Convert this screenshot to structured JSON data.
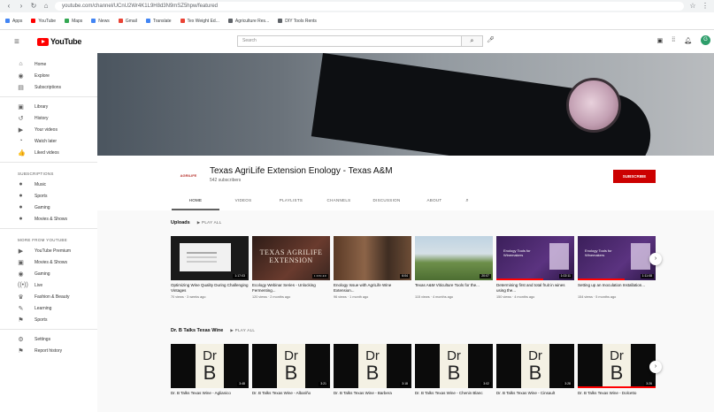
{
  "browser": {
    "url": "youtube.com/channel/UCnU2Wr4K1L9H8d3N9mSZ5hpw/featured",
    "bookmarks": [
      "Apps",
      "YouTube",
      "Maps",
      "News",
      "Gmail",
      "Translate",
      "Tex Weight Ed...",
      "Agriculture Res...",
      "DIY Tools Rents"
    ]
  },
  "masthead": {
    "logo_text": "YouTube",
    "search_placeholder": "Search"
  },
  "sidebar": {
    "main": [
      {
        "icon": "⌂",
        "label": "Home"
      },
      {
        "icon": "◉",
        "label": "Explore"
      },
      {
        "icon": "▤",
        "label": "Subscriptions"
      }
    ],
    "library": [
      {
        "icon": "▣",
        "label": "Library"
      },
      {
        "icon": "↺",
        "label": "History"
      },
      {
        "icon": "▶",
        "label": "Your videos"
      },
      {
        "icon": "◔",
        "label": "Watch later"
      },
      {
        "icon": "👍",
        "label": "Liked videos"
      }
    ],
    "subscriptions_heading": "SUBSCRIPTIONS",
    "subscriptions": [
      {
        "icon": "●",
        "label": "Music"
      },
      {
        "icon": "●",
        "label": "Sports"
      },
      {
        "icon": "●",
        "label": "Gaming"
      },
      {
        "icon": "●",
        "label": "Movies & Shows"
      }
    ],
    "more_heading": "MORE FROM YOUTUBE",
    "more": [
      {
        "icon": "▶",
        "label": "YouTube Premium"
      },
      {
        "icon": "▣",
        "label": "Movies & Shows"
      },
      {
        "icon": "◉",
        "label": "Gaming"
      },
      {
        "icon": "((•))",
        "label": "Live"
      },
      {
        "icon": "♛",
        "label": "Fashion & Beauty"
      },
      {
        "icon": "✎",
        "label": "Learning"
      },
      {
        "icon": "⚑",
        "label": "Sports"
      }
    ],
    "bottom": [
      {
        "icon": "⚙",
        "label": "Settings"
      },
      {
        "icon": "⚑",
        "label": "Report history"
      }
    ]
  },
  "channel": {
    "avatar_text": "AGRILIFE",
    "title": "Texas AgriLife Extension Enology - Texas A&M",
    "subscribers": "542 subscribers",
    "subscribe_label": "SUBSCRIBE",
    "tabs": [
      "HOME",
      "VIDEOS",
      "PLAYLISTS",
      "CHANNELS",
      "DISCUSSION",
      "ABOUT"
    ]
  },
  "shelf1": {
    "title": "Uploads",
    "play_all": "▶ PLAY ALL",
    "videos": [
      {
        "title": "Optimizing Wine Quality During Challenging Vintages",
        "meta": "70 views · 3 weeks ago",
        "duration": "1:17:03",
        "thumb": "slide"
      },
      {
        "title": "Ecology Webinar Series - Unlocking Fermenting...",
        "meta": "120 views · 2 months ago",
        "duration": "1:06:40",
        "thumb": "agri",
        "thumb_text": "TEXAS AGRILIFE EXTENSION"
      },
      {
        "title": "Enology Issue with AgriLife Wine Extension...",
        "meta": "96 views · 1 month ago",
        "duration": "6:04",
        "thumb": "people"
      },
      {
        "title": "Texas A&M Viticulture Tools for the...",
        "meta": "115 views · 4 months ago",
        "duration": "20:07",
        "thumb": "vine"
      },
      {
        "title": "Determining first and total fruit in wines using the...",
        "meta": "150 views · 4 months ago",
        "duration": "1:02:11",
        "thumb": "purple",
        "thumb_text": "Enology Tools for Winemakers"
      },
      {
        "title": "Setting up an Inoculation Installation...",
        "meta": "154 views · 5 months ago",
        "duration": "1:11:08",
        "thumb": "purple",
        "thumb_text": "Enology Tools for Winemakers"
      }
    ]
  },
  "shelf2": {
    "title": "Dr. B Talks Texas Wine",
    "play_all": "▶ PLAY ALL",
    "videos": [
      {
        "title": "Dr. B Talks Texas Wine - Aglianico",
        "duration": "3:48"
      },
      {
        "title": "Dr. B Talks Texas Wine - Albariño",
        "duration": "3:21"
      },
      {
        "title": "Dr. B Talks Texas Wine - Barbera",
        "duration": "3:18"
      },
      {
        "title": "Dr. B Talks Texas Wine - Chenin Blanc",
        "duration": "3:02"
      },
      {
        "title": "Dr. B Talks Texas Wine - Cinsault",
        "duration": "3:28"
      },
      {
        "title": "Dr. B Talks Texas Wine - Dolcetto",
        "duration": "3:26"
      }
    ],
    "thumb_text_top": "Dr",
    "thumb_text_bottom": "B"
  }
}
